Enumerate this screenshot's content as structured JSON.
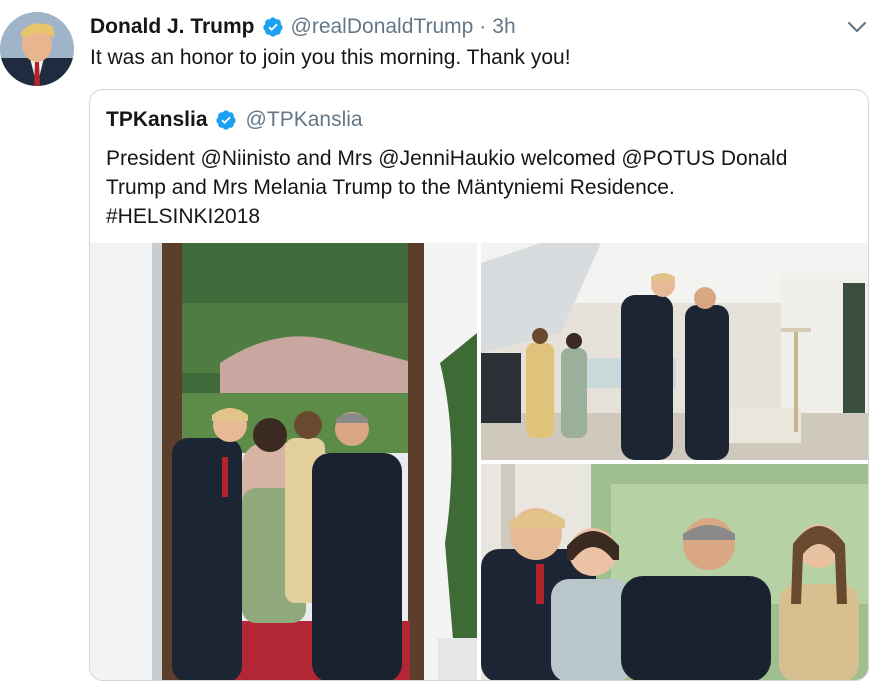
{
  "tweet": {
    "display_name": "Donald J. Trump",
    "handle": "@realDonaldTrump",
    "separator": "·",
    "time": "3h",
    "text": "It was an honor to join you this morning. Thank you!",
    "verified": true
  },
  "quoted_tweet": {
    "display_name": "TPKanslia",
    "handle": "@TPKanslia",
    "verified": true,
    "text_lines": [
      "President @Niinisto and Mrs @JenniHaukio welcomed @POTUS Donald",
      "Trump and Mrs Melania Trump to the Mäntyniemi Residence.",
      "#HELSINKI2018"
    ],
    "photos": [
      {
        "name": "doorway-greeting-photo"
      },
      {
        "name": "hallway-walk-photo"
      },
      {
        "name": "conversation-photo"
      }
    ]
  },
  "colors": {
    "text": "#14171a",
    "secondary": "#657786",
    "verified_blue": "#1da1f2",
    "border": "#ccd6dd"
  },
  "icons": {
    "verified": "verified-badge-icon",
    "caret": "chevron-down-icon"
  }
}
